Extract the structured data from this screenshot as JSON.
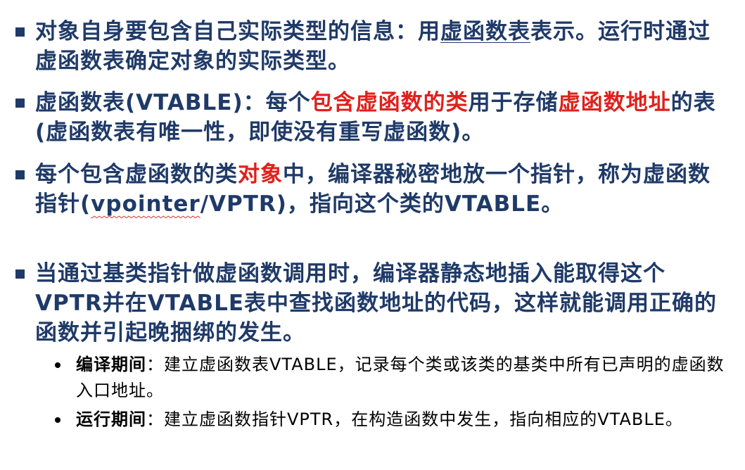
{
  "bullets": [
    {
      "part1": "对象自身要包含自己实际类型的信息：用",
      "underline": "虚函数表",
      "part2": "表示。运行时通过虚函数表确定对象的实际类型。"
    },
    {
      "part1": "虚函数表(VTABLE)：每个",
      "red1": "包含虚函数的类",
      "part2": "用于存储",
      "red2": "虚函数地址",
      "part3": "的表(虚函数表有唯一性，即使没有重写虚函数)。"
    },
    {
      "part1": "每个包含虚函数的类",
      "red1": "对象",
      "part2": "中，编译器秘密地放一个指针，称为虚函数指针(",
      "wavy": "vpointer",
      "part3": "/VPTR)，指向这个类的VTABLE。"
    },
    {
      "text": "当通过基类指针做虚函数调用时，编译器静态地插入能取得这个VPTR并在VTABLE表中查找函数地址的代码，这样就能调用正确的函数并引起晚捆绑的发生。"
    }
  ],
  "sub_bullets": [
    {
      "term": "编译期间",
      "text": "：建立虚函数表VTABLE，记录每个类或该类的基类中所有已声明的虚函数入口地址。"
    },
    {
      "term": "运行期间",
      "text": "：建立虚函数指针VPTR，在构造函数中发生，指向相应的VTABLE。"
    }
  ],
  "colors": {
    "text_blue": "#1f3a68",
    "highlight_red": "#e0201c",
    "sub_text": "#000000"
  }
}
